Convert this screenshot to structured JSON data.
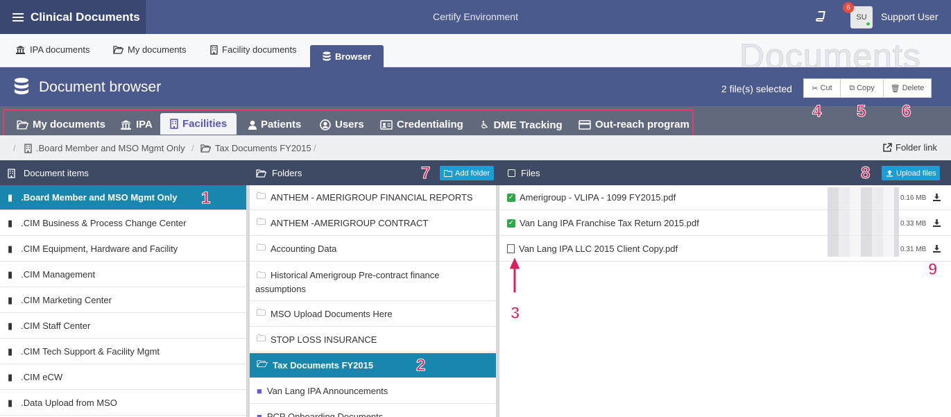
{
  "topbar": {
    "brand": "Clinical Documents",
    "environment": "Certify Environment",
    "notification_count": "6",
    "avatar_initials": "SU",
    "username": "Support User"
  },
  "top_tabs": [
    {
      "label": "IPA documents",
      "icon": "bank-icon"
    },
    {
      "label": "My documents",
      "icon": "folder-open-icon"
    },
    {
      "label": "Facility documents",
      "icon": "building-icon"
    },
    {
      "label": "Browser",
      "icon": "database-icon",
      "active": true
    }
  ],
  "watermark": "Documents",
  "browser_header": {
    "title": "Document browser",
    "selected_text": "2 file(s) selected",
    "cut_label": "Cut",
    "copy_label": "Copy",
    "delete_label": "Delete"
  },
  "categories": [
    {
      "label": "My documents",
      "icon": "folder-open-icon"
    },
    {
      "label": "IPA",
      "icon": "bank-icon"
    },
    {
      "label": "Facilities",
      "icon": "building-icon",
      "active": true
    },
    {
      "label": "Patients",
      "icon": "user-icon"
    },
    {
      "label": "Users",
      "icon": "user-circle-icon"
    },
    {
      "label": "Credentialing",
      "icon": "id-card-icon"
    },
    {
      "label": "DME Tracking",
      "icon": "wheelchair-icon"
    },
    {
      "label": "Out-reach program",
      "icon": "credit-card-icon"
    }
  ],
  "breadcrumb": {
    "items": [
      ".Board Member and MSO Mgmt Only",
      "Tax Documents FY2015"
    ],
    "folder_link": "Folder link"
  },
  "columns": {
    "doc_items": "Document items",
    "folders": "Folders",
    "files": "Files",
    "add_folder": "Add folder",
    "upload_files": "Upload files"
  },
  "document_items": [
    ".Board Member and MSO Mgmt Only",
    ".CIM Business & Process Change Center",
    ".CIM Equipment, Hardware and Facility",
    ".CIM Management",
    ".CIM Marketing Center",
    ".CIM Staff Center",
    ".CIM Tech Support & Facility Mgmt",
    ".CIM eCW",
    ".Data Upload from MSO"
  ],
  "folders": [
    "ANTHEM - AMERIGROUP FINANCIAL REPORTS",
    "ANTHEM -AMERIGROUP CONTRACT",
    "Accounting Data",
    "Historical Amerigroup Pre-contract finance assumptions",
    "MSO Upload Documents Here",
    "STOP LOSS INSURANCE",
    "Tax Documents FY2015",
    "Van Lang IPA Announcements",
    "PCP Onboarding Documents"
  ],
  "files": [
    {
      "name": "Amerigroup - VLIPA - 1099 FY2015.pdf",
      "size": "0.16 MB",
      "checked": true
    },
    {
      "name": "Van Lang IPA Franchise Tax Return 2015.pdf",
      "size": "0.33 MB",
      "checked": true
    },
    {
      "name": "Van Lang IPA LLC 2015 Client Copy.pdf",
      "size": "0.31 MB",
      "checked": false
    }
  ],
  "annotations": [
    "1",
    "2",
    "3",
    "4",
    "5",
    "6",
    "7",
    "8",
    "9"
  ],
  "colors": {
    "header": "#4a5a8c",
    "brand_bg": "#3a4773",
    "selected_row": "#1787ad",
    "accent_button": "#1a9ed6",
    "annotation": "#e21b5a",
    "highlight_frame": "#e43b72"
  }
}
